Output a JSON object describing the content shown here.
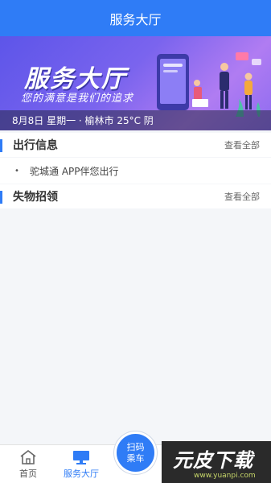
{
  "header": {
    "title": "服务大厅"
  },
  "banner": {
    "title": "服务大厅",
    "slogan": "您的满意是我们的追求",
    "info": "8月8日 星期一 · 榆林市 25°C 阴"
  },
  "sections": [
    {
      "title": "出行信息",
      "more": "查看全部"
    },
    {
      "title": "失物招领",
      "more": "查看全部"
    }
  ],
  "travel_items": [
    {
      "bullet": "•",
      "text": "驼城通 APP伴您出行"
    }
  ],
  "tabbar": {
    "tabs": [
      {
        "label": "首页",
        "icon": "home-icon",
        "color": "#555555"
      },
      {
        "label": "服务大厅",
        "icon": "monitor-icon",
        "color": "#2f7cf6"
      }
    ],
    "scan": {
      "line1": "扫码",
      "line2": "乘车"
    }
  },
  "watermark": {
    "text": "元皮下载",
    "url": "www.yuanpi.com"
  },
  "colors": {
    "primary": "#2f7cf6",
    "banner": "#6a5ceb"
  }
}
